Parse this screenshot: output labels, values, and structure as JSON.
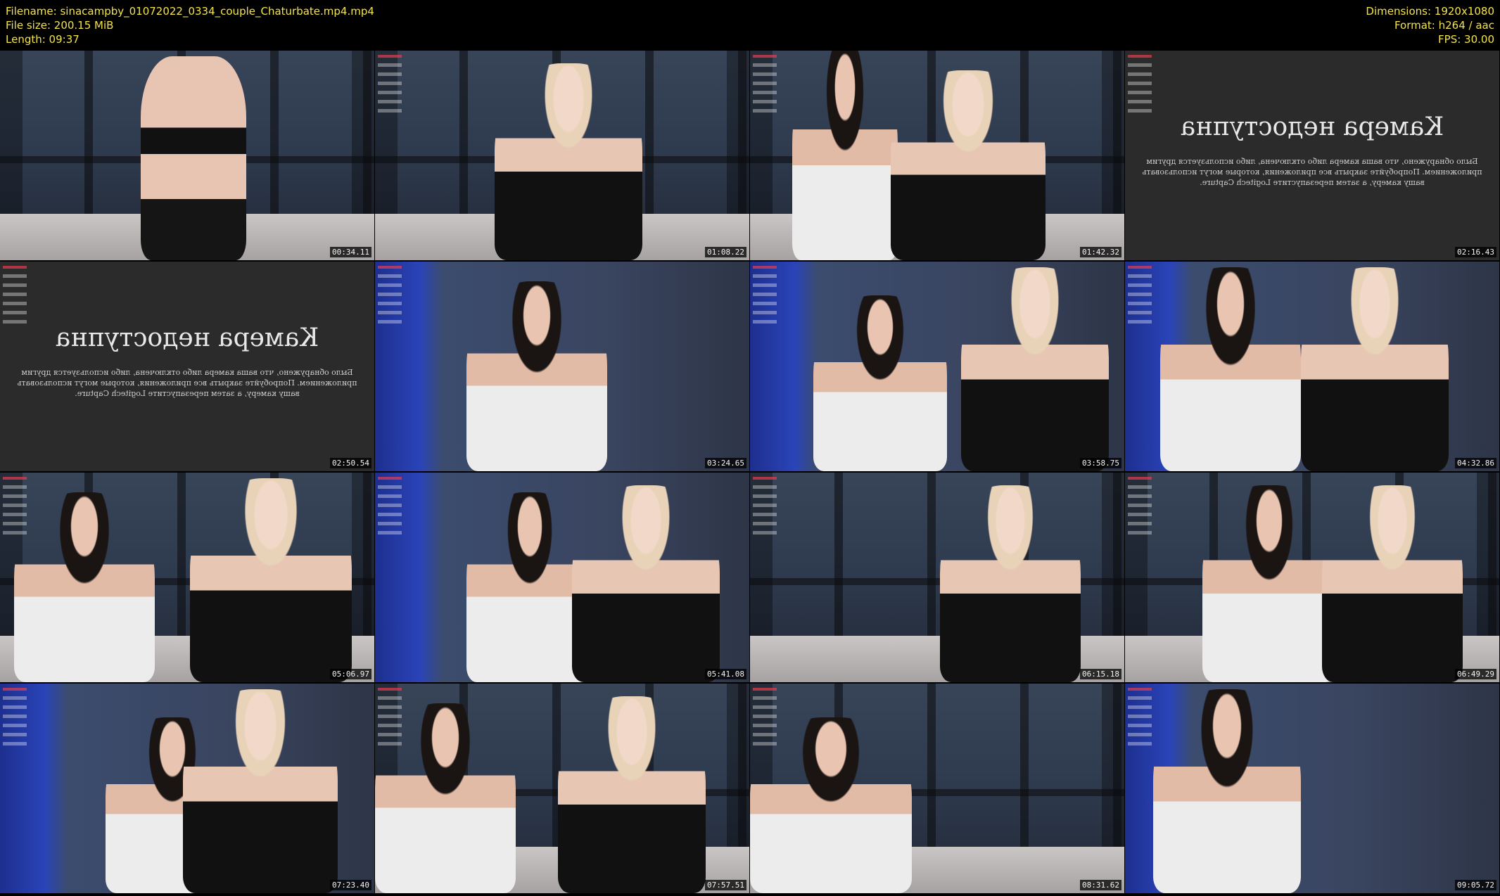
{
  "metadata": {
    "filename": "Filename: sinacampby_01072022_0334_couple_Chaturbate.mp4.mp4",
    "file_size": "File size: 200.15 MiB",
    "length": "Length: 09:37",
    "dimensions": "Dimensions: 1920x1080",
    "format": "Format: h264 / aac",
    "fps": "FPS: 30.00"
  },
  "thumbnails": [
    {
      "timestamp": "00:34.11"
    },
    {
      "timestamp": "01:08.22"
    },
    {
      "timestamp": "01:42.32"
    },
    {
      "timestamp": "02:16.43",
      "error_title": "Камера недоступна",
      "error_text": "Было обнаружено, что ваша камера либо отключена, либо используется другим приложением. Попробуйте закрыть все приложения, которые могут использовать вашу камеру, а затем перезапустите Logitech Capture."
    },
    {
      "timestamp": "02:50.54",
      "error_title": "Камера недоступна",
      "error_text": "Было обнаружено, что ваша камера либо отключена, либо используется другим приложением. Попробуйте закрыть все приложения, которые могут использовать вашу камеру, а затем перезапустите Logitech Capture."
    },
    {
      "timestamp": "03:24.65"
    },
    {
      "timestamp": "03:58.75"
    },
    {
      "timestamp": "04:32.86"
    },
    {
      "timestamp": "05:06.97"
    },
    {
      "timestamp": "05:41.08"
    },
    {
      "timestamp": "06:15.18"
    },
    {
      "timestamp": "06:49.29"
    },
    {
      "timestamp": "07:23.40"
    },
    {
      "timestamp": "07:57.51"
    },
    {
      "timestamp": "08:31.62"
    },
    {
      "timestamp": "09:05.72"
    }
  ]
}
